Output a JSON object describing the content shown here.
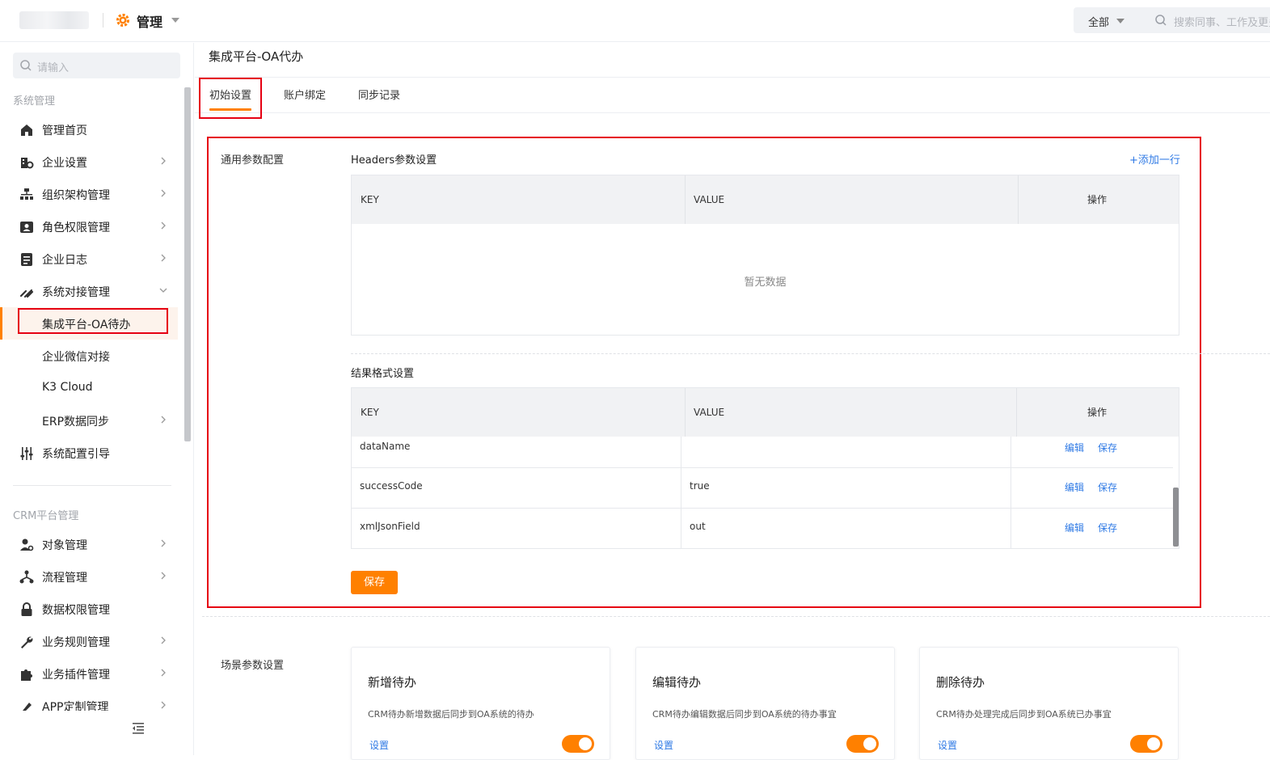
{
  "header": {
    "app_title": "管理",
    "scope_label": "全部",
    "search_placeholder": "搜索同事、工作及更多"
  },
  "sidebar": {
    "search_placeholder": "请输入",
    "group_system": "系统管理",
    "group_crm": "CRM平台管理",
    "items": [
      {
        "label": "管理首页"
      },
      {
        "label": "企业设置"
      },
      {
        "label": "组织架构管理"
      },
      {
        "label": "角色权限管理"
      },
      {
        "label": "企业日志"
      },
      {
        "label": "系统对接管理"
      },
      {
        "label": "集成平台-OA待办"
      },
      {
        "label": "企业微信对接"
      },
      {
        "label": "K3 Cloud"
      },
      {
        "label": "ERP数据同步"
      },
      {
        "label": "系统配置引导"
      },
      {
        "label": "对象管理"
      },
      {
        "label": "流程管理"
      },
      {
        "label": "数据权限管理"
      },
      {
        "label": "业务规则管理"
      },
      {
        "label": "业务插件管理"
      },
      {
        "label": "APP定制管理"
      }
    ]
  },
  "page": {
    "title": "集成平台-OA代办",
    "tabs": [
      "初始设置",
      "账户绑定",
      "同步记录"
    ]
  },
  "general": {
    "section_label": "通用参数配置",
    "headers_title": "Headers参数设置",
    "add_row": "+添加一行",
    "col_key": "KEY",
    "col_value": "VALUE",
    "col_action": "操作",
    "empty_text": "暂无数据",
    "result_title": "结果格式设置",
    "rows": [
      {
        "key": "dataName",
        "value": "",
        "edit": "编辑",
        "save": "保存"
      },
      {
        "key": "successCode",
        "value": "true",
        "edit": "编辑",
        "save": "保存"
      },
      {
        "key": "xmlJsonField",
        "value": "out",
        "edit": "编辑",
        "save": "保存"
      }
    ],
    "save_button": "保存"
  },
  "scene": {
    "section_label": "场景参数设置",
    "cards": [
      {
        "title": "新增待办",
        "desc": "CRM待办新增数据后同步到OA系统的待办",
        "setting": "设置",
        "enabled": true
      },
      {
        "title": "编辑待办",
        "desc": "CRM待办编辑数据后同步到OA系统的待办事宜",
        "setting": "设置",
        "enabled": true
      },
      {
        "title": "删除待办",
        "desc": "CRM待办处理完成后同步到OA系统已办事宜",
        "setting": "设置",
        "enabled": true
      }
    ]
  },
  "colors": {
    "accent": "#ff8000",
    "link": "#2f7ae5",
    "highlight_box": "#e60012"
  }
}
